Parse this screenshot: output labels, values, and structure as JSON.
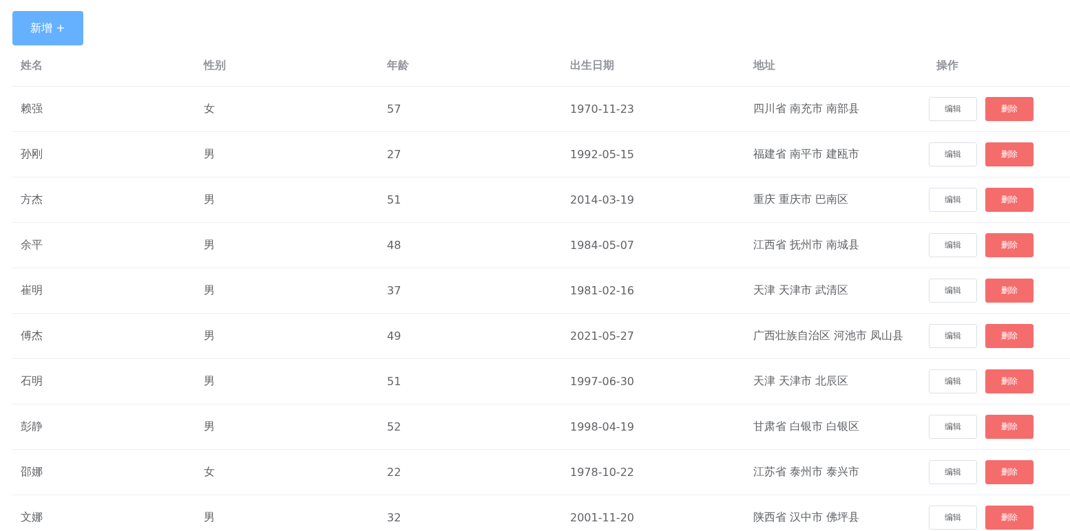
{
  "add_button": {
    "label": "新增 +"
  },
  "table": {
    "columns": [
      "姓名",
      "性别",
      "年龄",
      "出生日期",
      "地址",
      "操作"
    ],
    "rows": [
      {
        "name": "赖强",
        "gender": "女",
        "age": "57",
        "birth": "1970-11-23",
        "address": "四川省 南充市 南部县",
        "actions": [
          "编辑",
          "删除"
        ]
      },
      {
        "name": "孙刚",
        "gender": "男",
        "age": "27",
        "birth": "1992-05-15",
        "address": "福建省 南平市 建瓯市",
        "actions": [
          "编辑",
          "删除"
        ]
      },
      {
        "name": "方杰",
        "gender": "男",
        "age": "51",
        "birth": "2014-03-19",
        "address": "重庆 重庆市 巴南区",
        "actions": [
          "编辑",
          "删除"
        ]
      },
      {
        "name": "余平",
        "gender": "男",
        "age": "48",
        "birth": "1984-05-07",
        "address": "江西省 抚州市 南城县",
        "actions": [
          "编辑",
          "删除"
        ]
      },
      {
        "name": "崔明",
        "gender": "男",
        "age": "37",
        "birth": "1981-02-16",
        "address": "天津 天津市 武清区",
        "actions": [
          "编辑",
          "删除"
        ]
      },
      {
        "name": "傅杰",
        "gender": "男",
        "age": "49",
        "birth": "2021-05-27",
        "address": "广西壮族自治区 河池市 凤山县",
        "actions": [
          "编辑",
          "删除"
        ]
      },
      {
        "name": "石明",
        "gender": "男",
        "age": "51",
        "birth": "1997-06-30",
        "address": "天津 天津市 北辰区",
        "actions": [
          "编辑",
          "删除"
        ]
      },
      {
        "name": "彭静",
        "gender": "男",
        "age": "52",
        "birth": "1998-04-19",
        "address": "甘肃省 白银市 白银区",
        "actions": [
          "编辑",
          "删除"
        ]
      },
      {
        "name": "邵娜",
        "gender": "女",
        "age": "22",
        "birth": "1978-10-22",
        "address": "江苏省 泰州市 泰兴市",
        "actions": [
          "编辑",
          "删除"
        ]
      },
      {
        "name": "文娜",
        "gender": "男",
        "age": "32",
        "birth": "2001-11-20",
        "address": "陕西省 汉中市 佛坪县",
        "actions": [
          "编辑",
          "删除"
        ]
      }
    ]
  }
}
